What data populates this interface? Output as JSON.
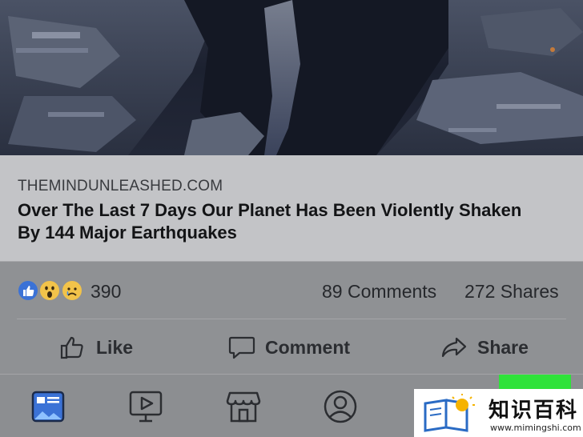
{
  "link_preview": {
    "domain": "THEMINDUNLEASHED.COM",
    "headline": "Over The Last 7 Days Our Planet Has Been Violently Shaken By 144 Major Earthquakes"
  },
  "stats": {
    "reactions": [
      "like-reaction-icon",
      "wow-reaction-icon",
      "sad-reaction-icon"
    ],
    "reaction_count": "390",
    "comments": "89 Comments",
    "shares": "272 Shares"
  },
  "actions": {
    "like_label": "Like",
    "comment_label": "Comment",
    "share_label": "Share"
  },
  "tabbar": {
    "tabs": [
      "news-feed-icon",
      "watch-icon",
      "marketplace-icon",
      "profile-icon"
    ],
    "highlight_color": "#2fe23a"
  },
  "watermark": {
    "name": "知识百科",
    "url": "www.mimingshi.com"
  }
}
